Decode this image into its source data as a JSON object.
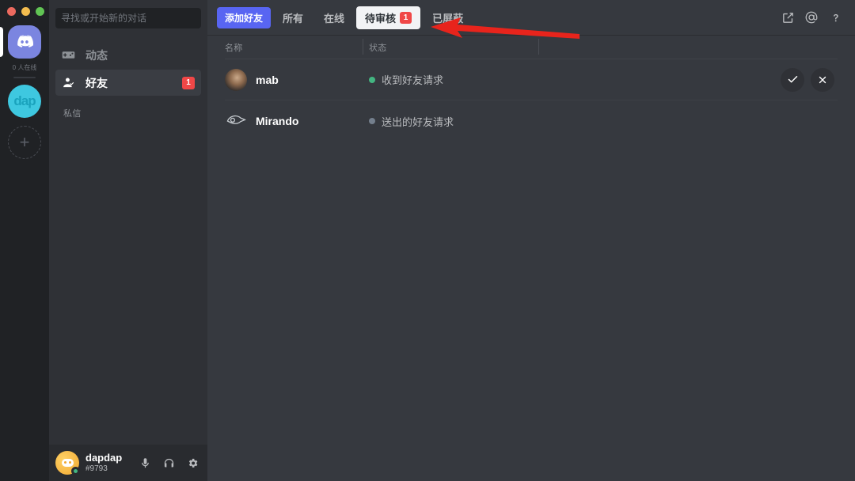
{
  "window": {
    "traffic_lights": [
      "close",
      "minimize",
      "maximize"
    ]
  },
  "rail": {
    "home_icon": "discord-home-icon",
    "online_count_label": "0 人在线",
    "servers": [
      {
        "name": "dap",
        "label": "dap",
        "icon": "dap-server-icon"
      }
    ],
    "add_server_label": "+"
  },
  "sidebar": {
    "search": {
      "placeholder": "寻找或开始新的对话",
      "value": ""
    },
    "nav": [
      {
        "id": "activity",
        "label": "动态",
        "icon": "gamepad-icon",
        "active": false,
        "badge": ""
      },
      {
        "id": "friends",
        "label": "好友",
        "icon": "friends-icon",
        "active": true,
        "badge": "1"
      }
    ],
    "dm_header": "私信"
  },
  "user_panel": {
    "name": "dapdap",
    "tag": "#9793",
    "status": "online",
    "icons": [
      {
        "name": "microphone-icon",
        "label": "麦克风"
      },
      {
        "name": "headphones-icon",
        "label": "耳机"
      },
      {
        "name": "gear-icon",
        "label": "用户设置"
      }
    ]
  },
  "topbar": {
    "add_friend_label": "添加好友",
    "tabs": [
      {
        "id": "all",
        "label": "所有",
        "active": false,
        "badge": ""
      },
      {
        "id": "online",
        "label": "在线",
        "active": false,
        "badge": ""
      },
      {
        "id": "pending",
        "label": "待审核",
        "active": true,
        "badge": "1"
      },
      {
        "id": "blocked",
        "label": "已屏蔽",
        "active": false,
        "badge": ""
      }
    ],
    "icons": [
      {
        "name": "new-dm-icon"
      },
      {
        "name": "mentions-icon"
      },
      {
        "name": "help-icon"
      }
    ]
  },
  "friend_list": {
    "columns": {
      "name": "名称",
      "status": "状态"
    },
    "rows": [
      {
        "username": "mab",
        "status_text": "收到好友请求",
        "status_color": "#43b581",
        "avatar_type": "photo",
        "has_actions": true,
        "accept_label": "接受",
        "decline_label": "拒绝"
      },
      {
        "username": "Mirando",
        "status_text": "送出的好友请求",
        "status_color": "#747f8d",
        "avatar_type": "logo",
        "has_actions": false,
        "accept_label": "",
        "decline_label": ""
      }
    ]
  },
  "annotation": {
    "arrow_color": "#e8241c",
    "points_to": "pending-tab"
  },
  "colors": {
    "blurple": "#5865f2",
    "danger": "#f04747",
    "online": "#43b581",
    "offline": "#747f8d",
    "bg_main": "#36393f",
    "bg_sidebar": "#2f3136",
    "bg_rail": "#202225"
  }
}
